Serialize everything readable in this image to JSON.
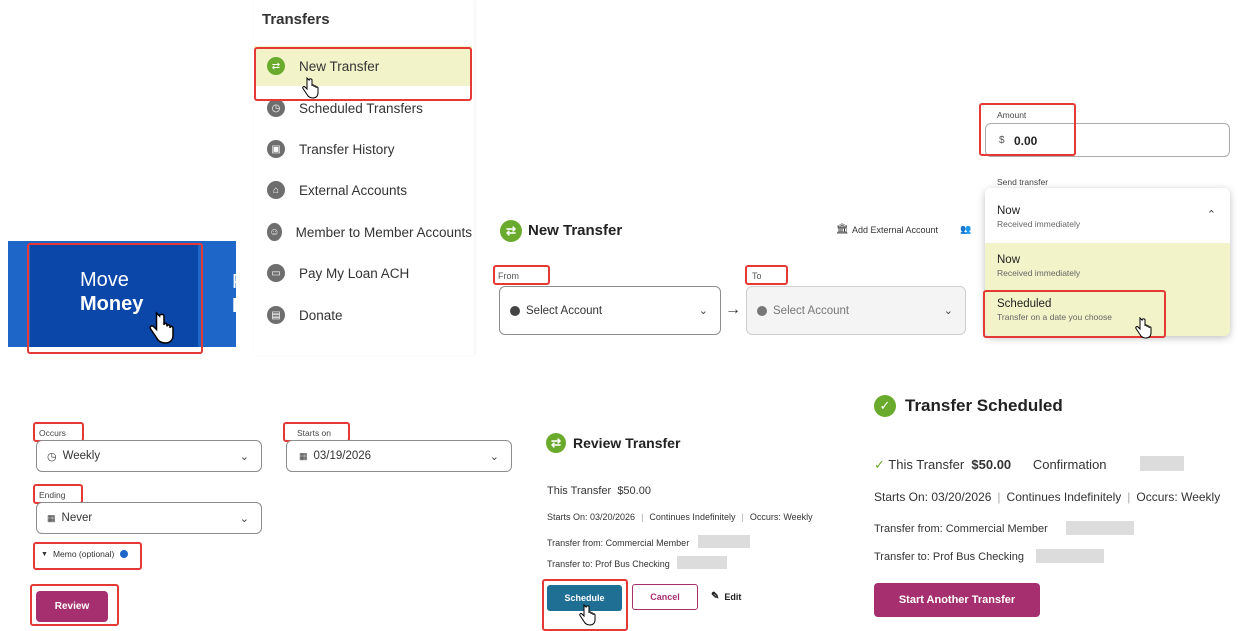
{
  "move_money": {
    "line1": "Move",
    "line2": "Money",
    "next_tile_fragment_top": "P",
    "next_tile_fragment_bottom": "E"
  },
  "menu": {
    "title": "Transfers",
    "items": [
      {
        "label": "New Transfer",
        "icon": "transfer-icon"
      },
      {
        "label": "Scheduled Transfers",
        "icon": "clock-icon"
      },
      {
        "label": "Transfer History",
        "icon": "calendar-icon"
      },
      {
        "label": "External Accounts",
        "icon": "bank-icon"
      },
      {
        "label": "Member to Member Accounts",
        "icon": "people-icon"
      },
      {
        "label": "Pay My Loan ACH",
        "icon": "card-icon"
      },
      {
        "label": "Donate",
        "icon": "gift-icon"
      }
    ]
  },
  "new_transfer": {
    "title": "New Transfer",
    "add_external": "Add External Account",
    "from_label": "From",
    "to_label": "To",
    "from_placeholder": "Select Account",
    "to_placeholder": "Select Account"
  },
  "amount": {
    "label": "Amount",
    "currency": "$",
    "value": "0.00"
  },
  "send_transfer": {
    "label": "Send transfer",
    "selected": {
      "title": "Now",
      "sub": "Received immediately"
    },
    "options": [
      {
        "title": "Now",
        "sub": "Received immediately"
      },
      {
        "title": "Scheduled",
        "sub": "Transfer on a date you choose"
      }
    ]
  },
  "schedule_form": {
    "occurs_label": "Occurs",
    "occurs_value": "Weekly",
    "starts_label": "Starts on",
    "starts_value": "03/19/2026",
    "ending_label": "Ending",
    "ending_value": "Never",
    "memo_label": "Memo (optional)",
    "review_button": "Review"
  },
  "review": {
    "title": "Review Transfer",
    "this_transfer": "This Transfer",
    "amount": "$50.00",
    "starts_on": "Starts On: 03/20/2026",
    "continues": "Continues Indefinitely",
    "occurs": "Occurs: Weekly",
    "from": "Transfer from: Commercial Member",
    "to": "Transfer to: Prof Bus Checking",
    "schedule_button": "Schedule",
    "cancel_button": "Cancel",
    "edit_button": "Edit"
  },
  "scheduled": {
    "title": "Transfer Scheduled",
    "this_transfer": "This Transfer",
    "amount": "$50.00",
    "confirmation": "Confirmation",
    "starts_on": "Starts On: 03/20/2026",
    "continues": "Continues Indefinitely",
    "occurs": "Occurs: Weekly",
    "from": "Transfer from: Commercial Member",
    "to": "Transfer to: Prof Bus Checking",
    "another_button": "Start Another Transfer"
  },
  "colors": {
    "primary_blue": "#0a47a8",
    "green": "#6aab2e",
    "magenta": "#a6306f",
    "teal": "#1f6f94",
    "highlight": "#e53935"
  }
}
